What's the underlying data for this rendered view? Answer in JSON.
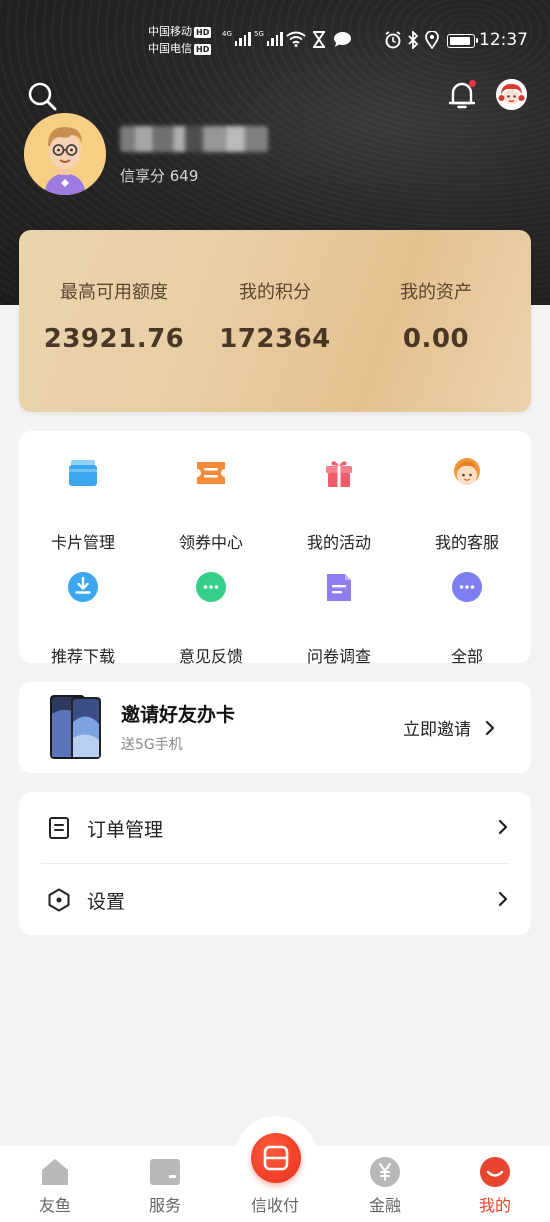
{
  "status_bar": {
    "carrier1": "中国移动",
    "carrier2": "中国电信",
    "hd": "HD",
    "net1": "4G",
    "net2": "5G",
    "time": "12:37"
  },
  "profile": {
    "score_label": "信享分 649"
  },
  "summary": {
    "items": [
      {
        "label": "最高可用额度",
        "value": "23921.76"
      },
      {
        "label": "我的积分",
        "value": "172364"
      },
      {
        "label": "我的资产",
        "value": "0.00"
      }
    ]
  },
  "menu": {
    "items": [
      {
        "label": "卡片管理",
        "icon": "card-icon"
      },
      {
        "label": "领券中心",
        "icon": "coupon-icon"
      },
      {
        "label": "我的活动",
        "icon": "gift-icon"
      },
      {
        "label": "我的客服",
        "icon": "service-icon"
      },
      {
        "label": "推荐下载",
        "icon": "download-icon"
      },
      {
        "label": "意见反馈",
        "icon": "feedback-icon"
      },
      {
        "label": "问卷调查",
        "icon": "survey-icon"
      },
      {
        "label": "全部",
        "icon": "more-icon"
      }
    ]
  },
  "invite": {
    "title": "邀请好友办卡",
    "subtitle": "送5G手机",
    "action": "立即邀请"
  },
  "settings": {
    "items": [
      {
        "label": "订单管理",
        "icon": "order-icon"
      },
      {
        "label": "设置",
        "icon": "settings-icon"
      }
    ]
  },
  "nav": {
    "tabs": [
      {
        "label": "友鱼"
      },
      {
        "label": "服务"
      },
      {
        "label": "信收付"
      },
      {
        "label": "金融"
      },
      {
        "label": "我的"
      }
    ],
    "active": "我的"
  },
  "colors": {
    "accent": "#e8452f",
    "gold": "#e8cda3",
    "header": "#262626"
  }
}
